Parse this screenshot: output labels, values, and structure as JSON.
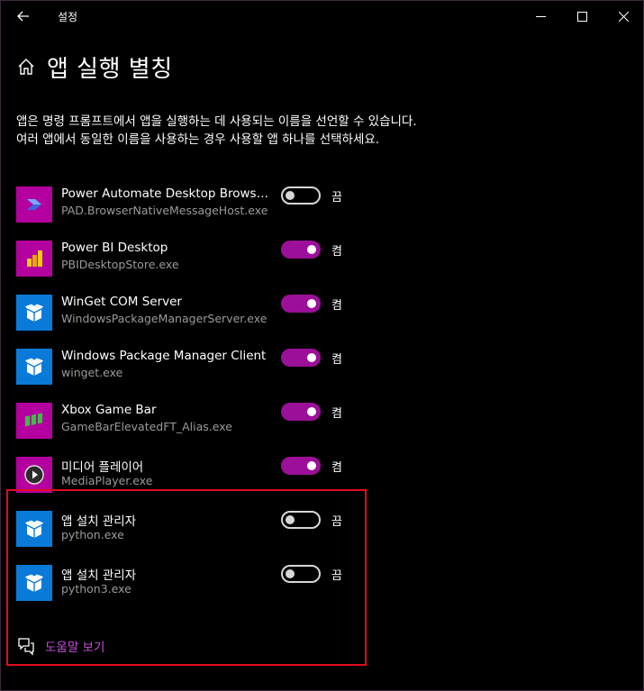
{
  "window": {
    "title": "설정",
    "controls": [
      "minimize",
      "maximize",
      "close"
    ]
  },
  "page": {
    "title": "앱 실행 별칭",
    "description": "앱은 명령 프롬프트에서 앱을 실행하는 데 사용되는 이름을 선언할 수 있습니다. 여러 앱에서 동일한 이름을 사용하는 경우 사용할 앱 하나를 선택하세요."
  },
  "apps": [
    {
      "name": "Power Automate Desktop Browser...",
      "exe": "PAD.BrowserNativeMessageHost.exe",
      "state": "끔",
      "on": false,
      "icon": "power-automate-icon"
    },
    {
      "name": "Power BI Desktop",
      "exe": "PBIDesktopStore.exe",
      "state": "켬",
      "on": true,
      "icon": "power-bi-icon"
    },
    {
      "name": "WinGet COM Server",
      "exe": "WindowsPackageManagerServer.exe",
      "state": "켬",
      "on": true,
      "icon": "package-box-icon"
    },
    {
      "name": "Windows Package Manager Client",
      "exe": "winget.exe",
      "state": "켬",
      "on": true,
      "icon": "package-box-icon"
    },
    {
      "name": "Xbox Game Bar",
      "exe": "GameBarElevatedFT_Alias.exe",
      "state": "켬",
      "on": true,
      "icon": "xbox-game-bar-icon"
    },
    {
      "name": "미디어 플레이어",
      "exe": "MediaPlayer.exe",
      "state": "켬",
      "on": true,
      "icon": "media-player-icon"
    },
    {
      "name": "앱 설치 관리자",
      "exe": "python.exe",
      "state": "끔",
      "on": false,
      "icon": "package-box-icon"
    },
    {
      "name": "앱 설치 관리자",
      "exe": "python3.exe",
      "state": "끔",
      "on": false,
      "icon": "package-box-icon"
    }
  ],
  "help": {
    "label": "도움말 보기",
    "icon": "help-chat-icon"
  },
  "colors": {
    "accent": "#9c0f99",
    "link": "#c34fd8",
    "highlight": "#e00b1c",
    "tile_blue": "#0a7ad9"
  }
}
